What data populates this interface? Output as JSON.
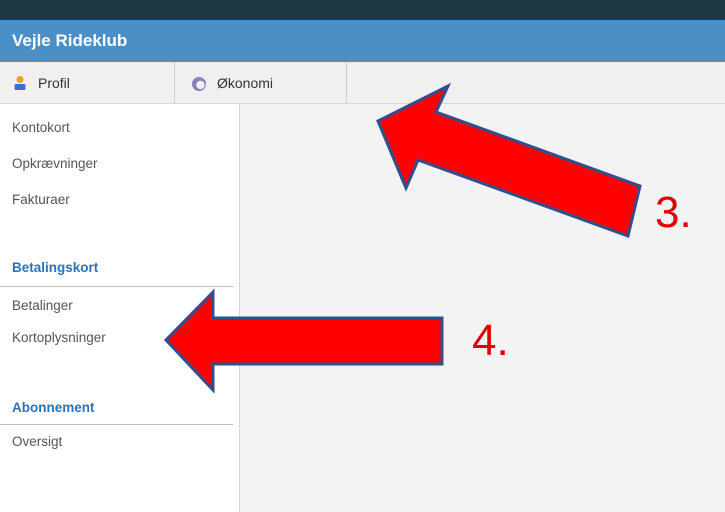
{
  "app": {
    "title": "Vejle Rideklub"
  },
  "tabs": [
    {
      "label": "Profil",
      "icon": "user-icon"
    },
    {
      "label": "Økonomi",
      "icon": "wallet-icon"
    }
  ],
  "sidebar": {
    "group1": [
      "Kontokort",
      "Opkrævninger",
      "Fakturaer"
    ],
    "section2": {
      "title": "Betalingskort",
      "items": [
        "Betalinger",
        "Kortoplysninger"
      ]
    },
    "section3": {
      "title": "Abonnement",
      "items": [
        "Oversigt"
      ]
    }
  },
  "annotations": [
    {
      "label": "3."
    },
    {
      "label": "4."
    }
  ],
  "colors": {
    "header_bg": "#4a8fc6",
    "top_strip": "#1d3a44",
    "section_heading": "#2d72b8",
    "arrow_fill": "#ff0000",
    "arrow_stroke": "#2f4f8f",
    "annotation_text": "#e00000"
  }
}
